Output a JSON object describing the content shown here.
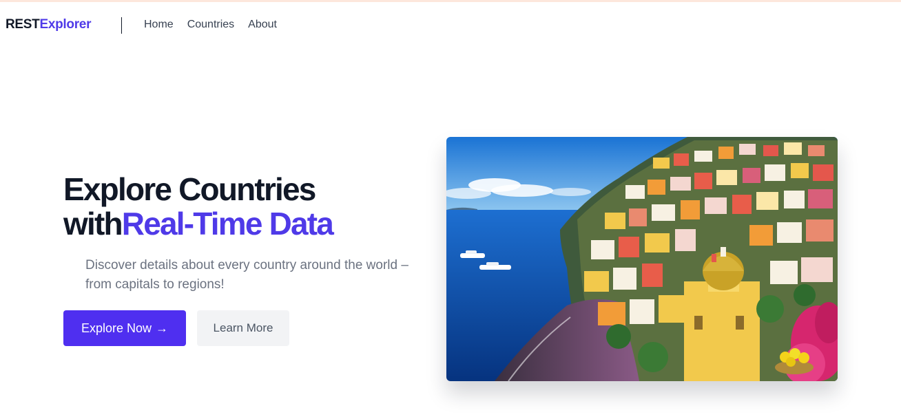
{
  "nav": {
    "brand_part1": "REST",
    "brand_part2": "Explorer",
    "links": [
      {
        "label": "Home"
      },
      {
        "label": "Countries"
      },
      {
        "label": "About"
      }
    ]
  },
  "hero": {
    "title_line1": "Explore Countries",
    "title_line2_prefix": "with",
    "title_line2_accent": "Real-Time Data",
    "subtitle": "Discover details about every country around the world – from capitals to regions!",
    "primary_button": "Explore Now",
    "primary_button_icon": "arrow-right-icon",
    "secondary_button": "Learn More",
    "image": {
      "content": "coastal-village-photo"
    }
  },
  "colors": {
    "brand_accent": "#4f3ae8",
    "primary_button": "#4f2ff0",
    "secondary_button": "#f2f3f5",
    "heading": "#111827",
    "body_text": "#6b7280"
  }
}
